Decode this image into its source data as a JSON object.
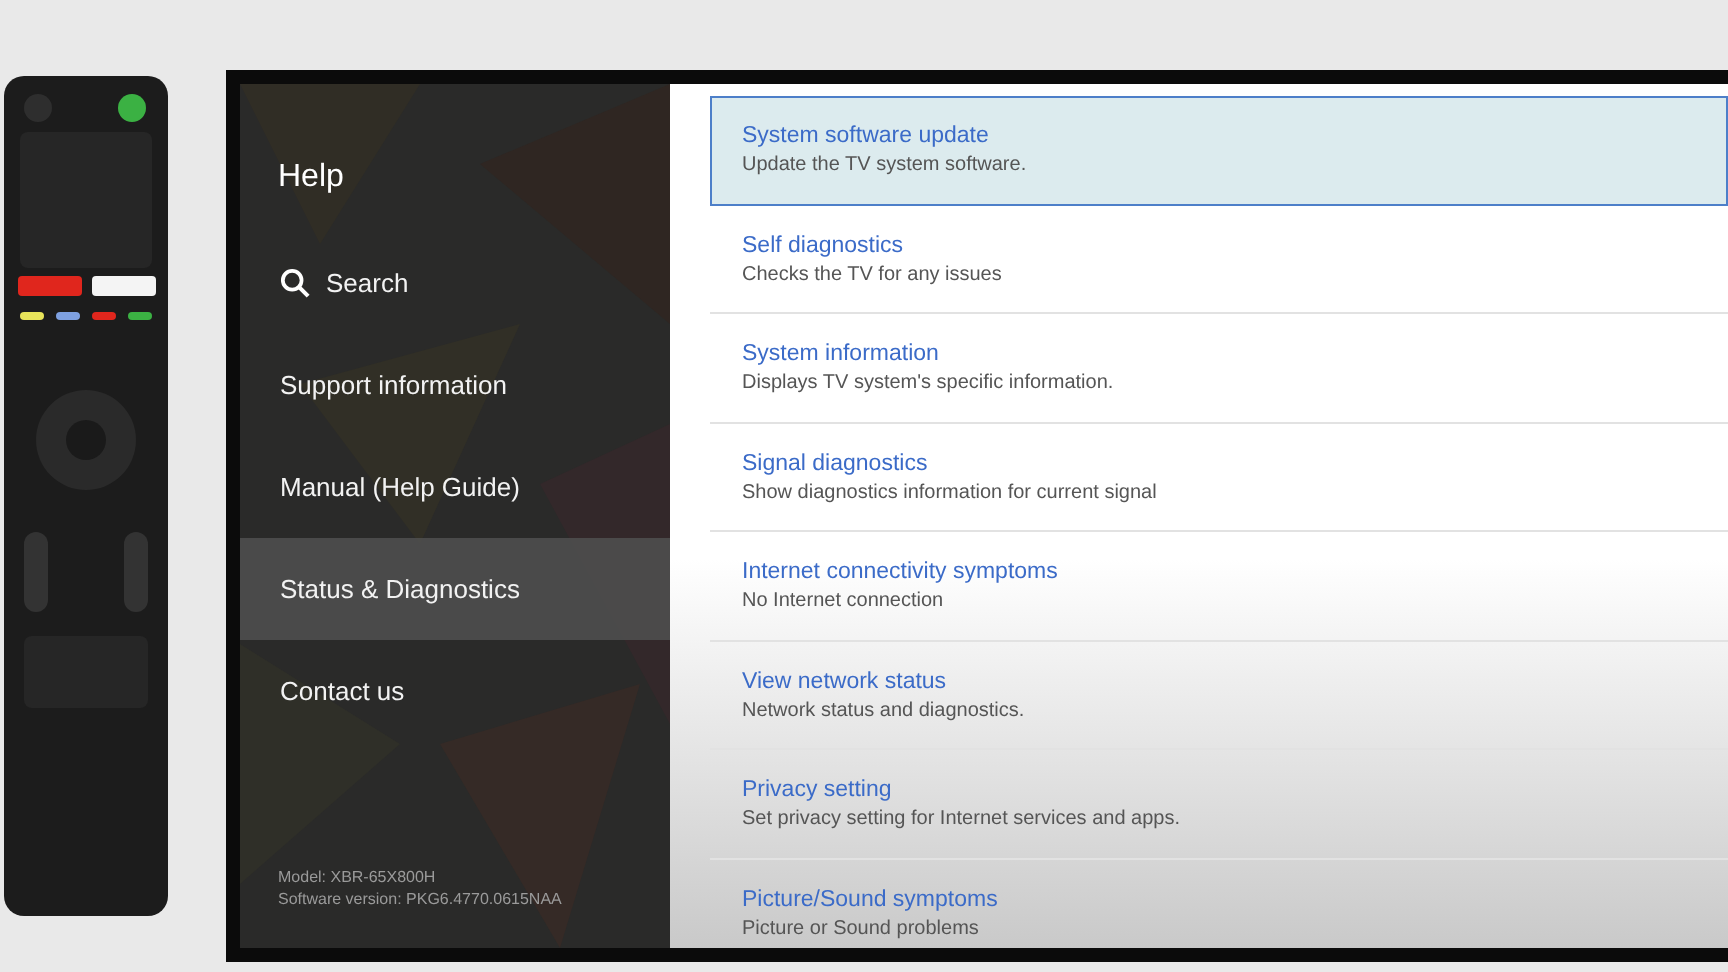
{
  "tv": {
    "sidebar": {
      "title": "Help",
      "items": [
        {
          "label": "Search",
          "kind": "search",
          "selected": false
        },
        {
          "label": "Support information",
          "kind": "text",
          "selected": false
        },
        {
          "label": "Manual (Help Guide)",
          "kind": "text",
          "selected": false
        },
        {
          "label": "Status & Diagnostics",
          "kind": "text",
          "selected": true
        },
        {
          "label": "Contact us",
          "kind": "text",
          "selected": false
        }
      ],
      "model": "Model: XBR-65X800H",
      "software_version": "Software version: PKG6.4770.0615NAA"
    },
    "list": [
      {
        "title": "System software update",
        "description": "Update the TV system software.",
        "selected": true
      },
      {
        "title": "Self diagnostics",
        "description": "Checks the TV for any issues",
        "selected": false
      },
      {
        "title": "System information",
        "description": "Displays TV system's specific information.",
        "selected": false
      },
      {
        "title": "Signal diagnostics",
        "description": "Show diagnostics information for current signal",
        "selected": false
      },
      {
        "title": "Internet connectivity symptoms",
        "description": "No Internet connection",
        "selected": false
      },
      {
        "title": "View network status",
        "description": "Network status and diagnostics.",
        "selected": false
      },
      {
        "title": "Privacy setting",
        "description": "Set privacy setting for Internet services and apps.",
        "selected": false
      },
      {
        "title": "Picture/Sound symptoms",
        "description": "Picture or Sound problems",
        "selected": false
      }
    ]
  }
}
